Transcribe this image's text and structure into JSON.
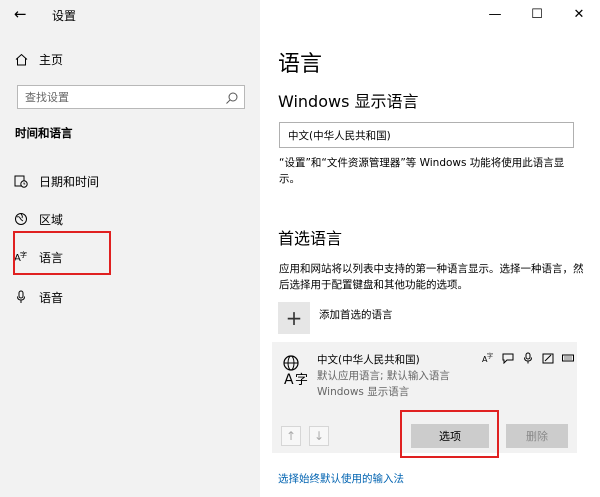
{
  "window": {
    "title": "设置",
    "back_icon": "arrow-left-icon",
    "minimize_glyph": "—",
    "maximize_glyph": "☐",
    "close_glyph": "✕"
  },
  "sidebar": {
    "home_label": "主页",
    "search_placeholder": "查找设置",
    "section_title": "时间和语言",
    "items": [
      {
        "label": "日期和时间",
        "icon": "calendar-clock-icon"
      },
      {
        "label": "区域",
        "icon": "globe-region-icon"
      },
      {
        "label": "语言",
        "icon": "language-icon"
      },
      {
        "label": "语音",
        "icon": "microphone-icon"
      }
    ]
  },
  "main": {
    "title": "语言",
    "display_language_heading": "Windows 显示语言",
    "display_language_value": "中文(中华人民共和国)",
    "display_language_desc": "“设置”和“文件资源管理器”等 Windows 功能将使用此语言显示。",
    "preferred_heading": "首选语言",
    "preferred_desc": "应用和网站将以列表中支持的第一种语言显示。选择一种语言，然后选择用于配置键盘和其他功能的选项。",
    "add_language_label": "添加首选的语言",
    "language_card": {
      "name": "中文(中华人民共和国)",
      "line1": "默认应用语言; 默认输入语言",
      "line2": "Windows 显示语言"
    },
    "options_button": "选项",
    "remove_button": "删除",
    "input_method_link": "选择始终默认使用的输入法"
  },
  "colors": {
    "sidebar_bg": "#f2f2f2",
    "highlight_red": "#e02020",
    "link_blue": "#0063b1",
    "button_gray": "#cccccc"
  }
}
